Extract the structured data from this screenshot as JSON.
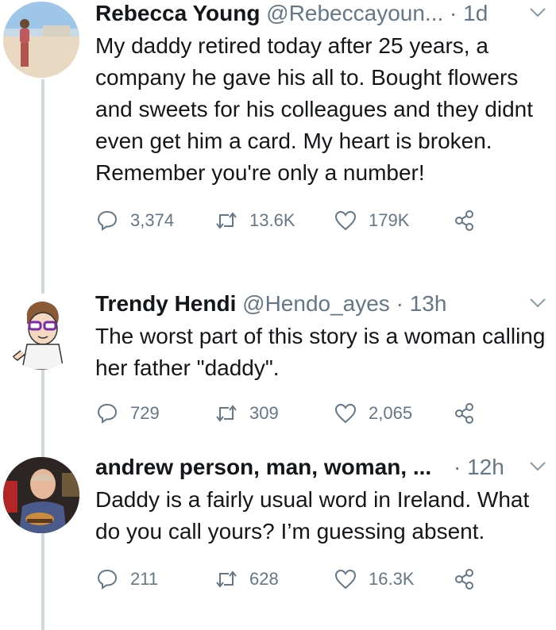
{
  "tweets": [
    {
      "name": "Rebecca Young",
      "handle": "@Rebeccayoun...",
      "time": "1d",
      "text": "My daddy retired today after 25 years, a company he gave his all to. Bought flowers and sweets for his colleagues and they didnt even get him a card. My heart is broken. Remember you're only a number!",
      "replies": "3,374",
      "retweets": "13.6K",
      "likes": "179K",
      "avatar_icon": "woman-on-beach-avatar"
    },
    {
      "name": "Trendy Hendi",
      "handle": "@Hendo_ayes",
      "time": "13h",
      "text": "The worst part of this story is a woman calling her father \"daddy\".",
      "replies": "729",
      "retweets": "309",
      "likes": "2,065",
      "avatar_icon": "cartoon-man-glasses-avatar"
    },
    {
      "name": "andrew person, man, woman, ...",
      "handle": "",
      "time": "12h",
      "text": "Daddy is a fairly usual word in Ireland. What do you call yours? I’m guessing absent.",
      "replies": "211",
      "retweets": "628",
      "likes": "16.3K",
      "avatar_icon": "man-with-burger-avatar"
    }
  ],
  "colors": {
    "text": "#14171a",
    "muted": "#657786",
    "thread_line": "#cfd9de"
  },
  "icons": [
    "reply-icon",
    "retweet-icon",
    "like-icon",
    "share-icon",
    "chevron-down-icon"
  ]
}
